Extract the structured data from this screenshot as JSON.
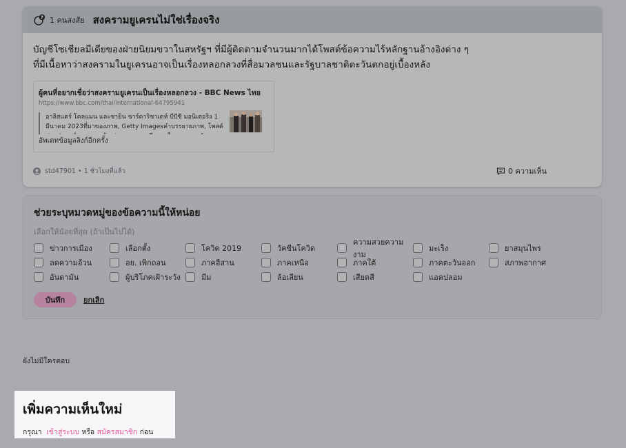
{
  "article": {
    "doubt_count": "1 คนสงสัย",
    "title": "สงครามยูเครนไม่ใช่เรื่องจริง",
    "body": "บัญชีโซเชียลมีเดียของฝ่ายนิยมขวาในสหรัฐฯ ที่มีผู้ติดตามจำนวนมากได้โพสต์ข้อความไร้หลักฐานอ้างอิงต่าง ๆ ที่มีเนื้อหาว่าสงครามในยูเครนอาจเป็นเรื่องหลอกลวงที่สื่อมวลชนและรัฐบาลชาติตะวันตกอยู่เบื้องหลัง",
    "link": {
      "title": "ผู้คนที่อยากเชื่อว่าสงครามยูเครนเป็นเรื่องหลอกลวง - BBC News ไทย",
      "url": "https://www.bbc.com/thai/international-64795941",
      "snippet": "อาลิสแตร์ โคลแมน และชายิน ชาร์ดาริชาเดห์ บีบีซี มอนิเตอริง 1 มีนาคม 2023ที่มาของภาพ, Getty Imagesคำบรรยายภาพ, โพสต์ข่าวปลอมจำนวนมากอ้างว่าภาพความเสียหายในยูเครนถูกจัดฉากขึ้น",
      "update_label": "อัพเดทข้อมูลลิงก์อีกครั้ง"
    },
    "author": "std47901",
    "time": "• 1 ชั่วโมงที่แล้ว",
    "comments": "0 ความเห็น"
  },
  "categories": {
    "title": "ช่วยระบุหมวดหมู่ของข้อความนี้ให้หน่อย",
    "subtitle": "เลือกให้น้อยที่สุด (ถ้าเป็นไปได้)",
    "items": [
      "ข่าวการเมือง",
      "เลือกตั้ง",
      "โควิด 2019",
      "วัคซีนโควิด",
      "ความสวยความงาม",
      "มะเร็ง",
      "ยาสมุนไพร",
      "ลดความอ้วน",
      "อย. เพิกถอน",
      "ภาคอีสาน",
      "ภาคเหนือ",
      "ภาคใต้",
      "ภาคตะวันออก",
      "สภาพอากาศ",
      "อันดามัน",
      "ผู้บริโภคเฝ้าระวัง",
      "มีม",
      "ล้อเลียน",
      "เสียดสี",
      "แอคปลอม"
    ],
    "save_label": "บันทึก",
    "cancel_label": "ยกเลิก"
  },
  "replies": {
    "empty_text": "ยังไม่มีใครตอบ"
  },
  "new_comment": {
    "title": "เพิ่มความเห็นใหม่",
    "prefix": "กรุณา",
    "login_label": "เข้าสู่ระบบ",
    "or": "หรือ",
    "register_label": "สมัครสมาชิก",
    "suffix": "ก่อน"
  },
  "colors": {
    "link_pink": "#e0569a",
    "save_button": "#b783a0"
  }
}
